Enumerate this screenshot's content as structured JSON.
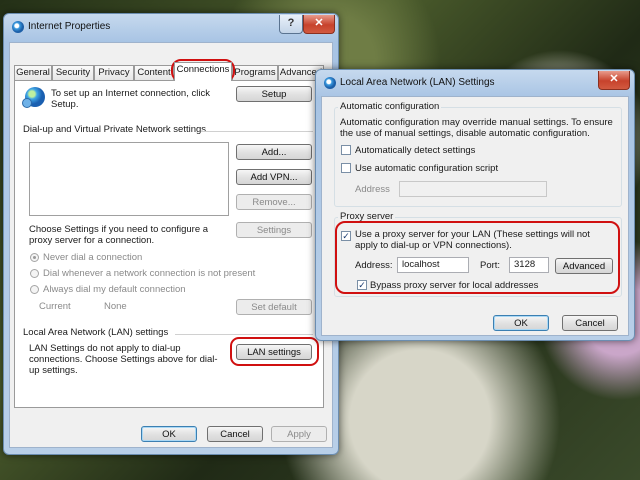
{
  "internet_properties": {
    "title": "Internet Properties",
    "help_label": "?",
    "close_label": "✕",
    "tabs": [
      "General",
      "Security",
      "Privacy",
      "Content",
      "Connections",
      "Programs",
      "Advanced"
    ],
    "active_tab": "Connections",
    "setup_text": "To set up an Internet connection, click Setup.",
    "setup_button": "Setup",
    "dialup_section": "Dial-up and Virtual Private Network settings",
    "add_button": "Add...",
    "add_vpn_button": "Add VPN...",
    "remove_button": "Remove...",
    "choose_settings_text": "Choose Settings if you need to configure a proxy server for a connection.",
    "settings_button": "Settings",
    "radio_never": "Never dial a connection",
    "radio_dial_whenever": "Dial whenever a network connection is not present",
    "radio_always": "Always dial my default connection",
    "current_label": "Current",
    "current_value": "None",
    "set_default_button": "Set default",
    "lan_section": "Local Area Network (LAN) settings",
    "lan_text": "LAN Settings do not apply to dial-up connections. Choose Settings above for dial-up settings.",
    "lan_settings_button": "LAN settings",
    "ok_button": "OK",
    "cancel_button": "Cancel",
    "apply_button": "Apply"
  },
  "lan_dialog": {
    "title": "Local Area Network (LAN) Settings",
    "close_label": "✕",
    "auto_config_group": "Automatic configuration",
    "auto_config_text": "Automatic configuration may override manual settings. To ensure the use of manual settings, disable automatic configuration.",
    "auto_detect_label": "Automatically detect settings",
    "auto_detect_checked": false,
    "use_script_label": "Use automatic configuration script",
    "use_script_checked": false,
    "script_address_label": "Address",
    "script_address_value": "",
    "proxy_group": "Proxy server",
    "use_proxy_label": "Use a proxy server for your LAN (These settings will not apply to dial-up or VPN connections).",
    "use_proxy_checked": true,
    "address_label": "Address:",
    "address_value": "localhost",
    "port_label": "Port:",
    "port_value": "3128",
    "advanced_button": "Advanced",
    "bypass_label": "Bypass proxy server for local addresses",
    "bypass_checked": true,
    "ok_button": "OK",
    "cancel_button": "Cancel"
  },
  "colors": {
    "highlight_outline": "#d01010",
    "title_bar": "#b8cfe8",
    "close_button": "#c7422c"
  },
  "icons": {
    "window_icon": "globe-icon",
    "setup_icon": "globe-network-icon"
  }
}
